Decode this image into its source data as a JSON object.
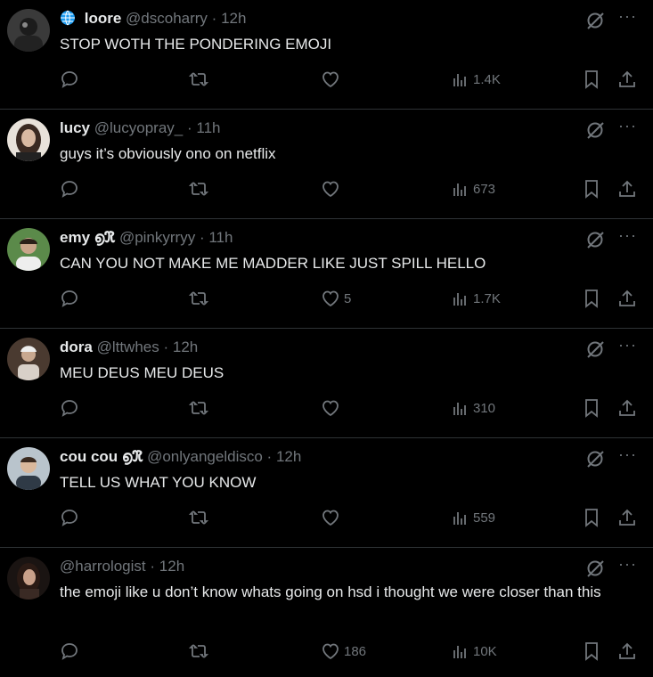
{
  "tweets": [
    {
      "name": "loore",
      "handle": "@dscoharry",
      "time": "12h",
      "text": "STOP WOTH THE PONDERING EMOJI",
      "likes": "",
      "views": "1.4K",
      "badge_icon": "globe-icon"
    },
    {
      "name": "lucy",
      "handle": "@lucyopray_",
      "time": "11h",
      "text": "guys it’s obviously ono on netflix",
      "likes": "",
      "views": "673"
    },
    {
      "name": "emy ൭ℜ",
      "handle": "@pinkyrryy",
      "time": "11h",
      "text": "CAN YOU NOT MAKE ME MADDER LIKE JUST SPILL HELLO",
      "likes": "5",
      "views": "1.7K"
    },
    {
      "name": "dora",
      "handle": "@lttwhes",
      "time": "12h",
      "text": "MEU DEUS MEU DEUS",
      "likes": "",
      "views": "310"
    },
    {
      "name": "cou cou ൭ℜ",
      "handle": "@onlyangeldisco",
      "time": "12h",
      "text": "TELL US WHAT YOU KNOW",
      "likes": "",
      "views": "559"
    },
    {
      "name": "",
      "handle": "@harrologist",
      "time": "12h",
      "text": "the emoji like u don’t know whats going on hsd i thought we were closer than this",
      "likes": "186",
      "views": "10K"
    }
  ],
  "separator": "·",
  "more_label": "···",
  "colors": {
    "background": "#000000",
    "text": "#e7e9ea",
    "muted": "#71767b",
    "divider": "#2f3336"
  }
}
